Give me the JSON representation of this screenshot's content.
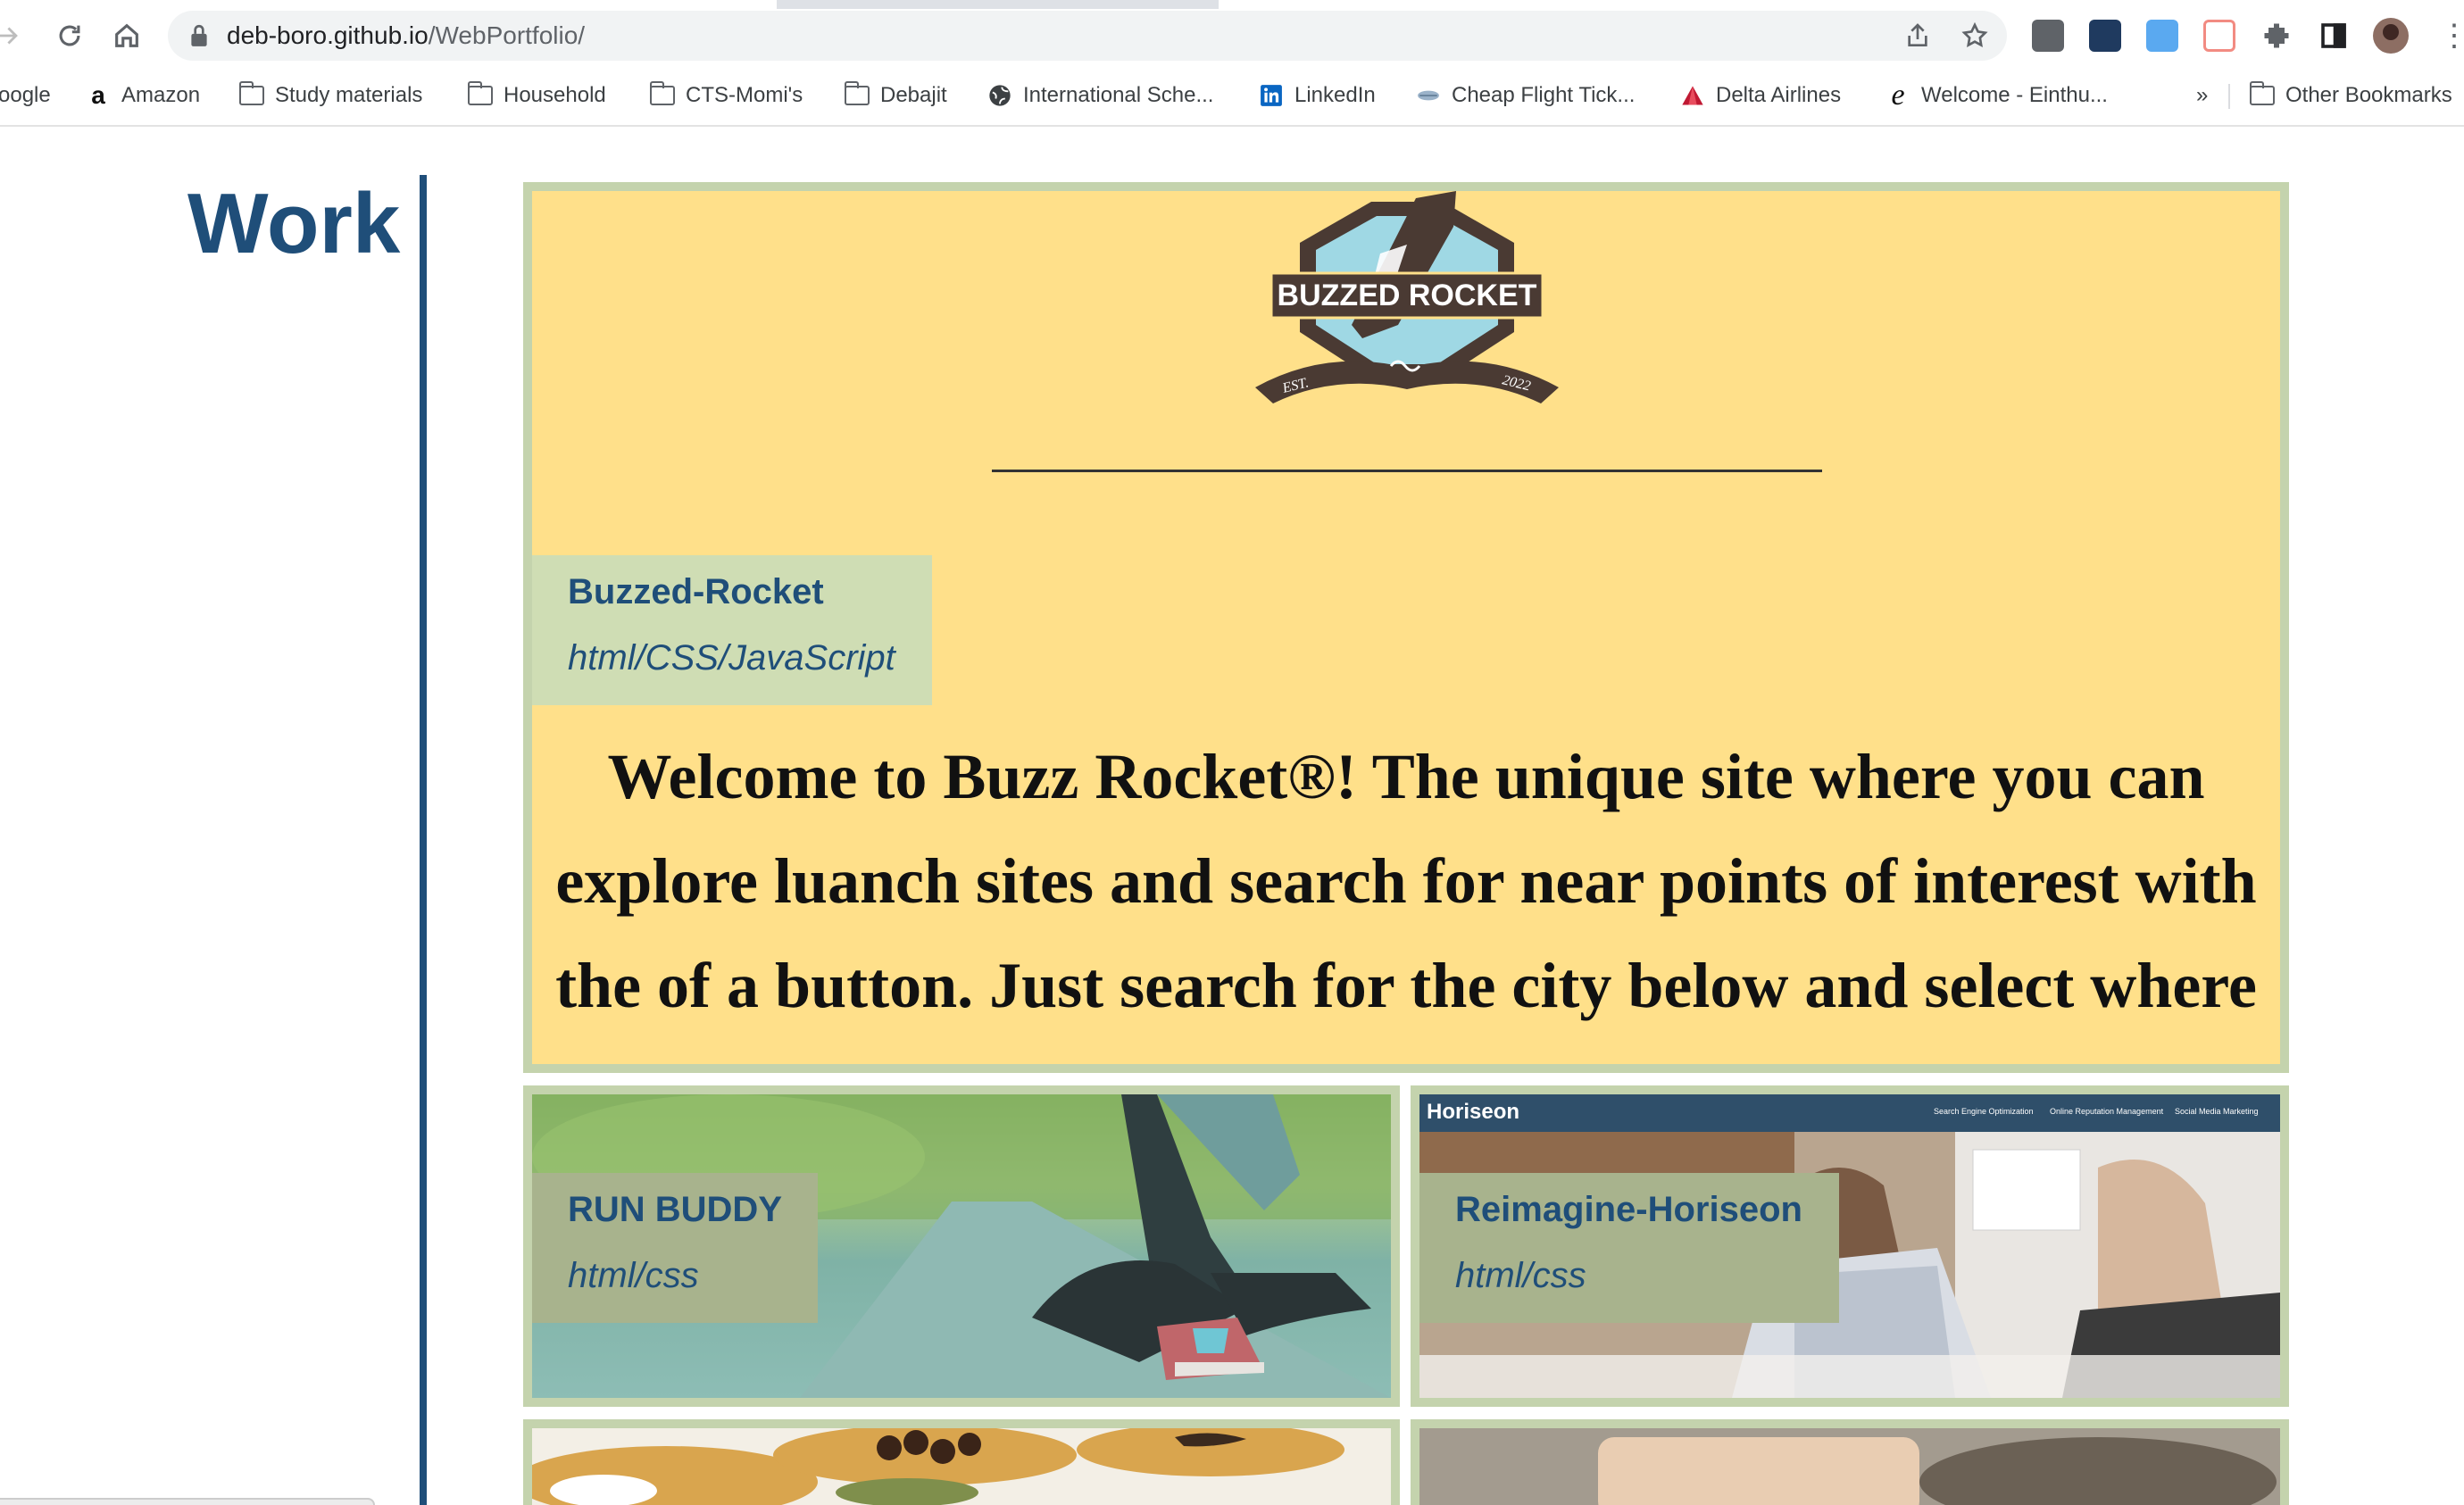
{
  "browser": {
    "url_host": "deb-boro.github.io",
    "url_path": "/WebPortfolio/",
    "bookmarks": [
      {
        "label": "oogle",
        "icon": "none"
      },
      {
        "label": "Amazon",
        "icon": "amazon-icon"
      },
      {
        "label": "Study materials",
        "icon": "folder-icon"
      },
      {
        "label": "Household",
        "icon": "folder-icon"
      },
      {
        "label": "CTS-Momi's",
        "icon": "folder-icon"
      },
      {
        "label": "Debajit",
        "icon": "folder-icon"
      },
      {
        "label": "International Sche...",
        "icon": "globe-icon"
      },
      {
        "label": "LinkedIn",
        "icon": "linkedin-icon"
      },
      {
        "label": "Cheap Flight Tick...",
        "icon": "plane-icon"
      },
      {
        "label": "Delta Airlines",
        "icon": "delta-icon"
      },
      {
        "label": "Welcome - Einthu...",
        "icon": "einthusan-icon"
      }
    ],
    "overflow_label": "»",
    "other_bookmarks": "Other Bookmarks"
  },
  "page": {
    "section_title": "Work",
    "featured": {
      "logo_text": "BUZZED ROCKET",
      "logo_est": "EST.",
      "logo_year": "2022",
      "name": "Buzzed-Rocket",
      "tech": "html/CSS/JavaScript",
      "welcome": "Welcome to Buzz Rocket®! The unique site where you can explore luanch sites and search for near points of interest with the of a button. Just search for the city below and select where you are interested in and Buzz Rocket® will"
    },
    "projects": [
      {
        "name": "RUN BUDDY",
        "tech": "html/css"
      },
      {
        "name": "Reimagine-Horiseon",
        "tech": "html/css",
        "banner_brand": "Horiseon",
        "banner_nav": [
          "Search Engine Optimization",
          "Online Reputation Management",
          "Social Media Marketing"
        ]
      }
    ]
  },
  "colors": {
    "accent": "#1f4e79",
    "card_border": "#c4d3ad",
    "featured_bg": "#ffe08a",
    "label_bg": "#cfddb4"
  }
}
